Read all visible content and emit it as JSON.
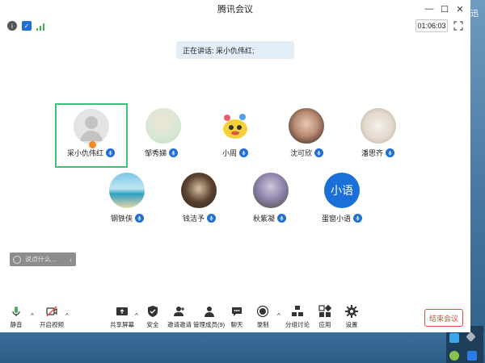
{
  "window": {
    "title": "腾讯会议",
    "timer": "01:06:03"
  },
  "desktop": {
    "edge_text": "迅"
  },
  "speaking": {
    "label": "正在讲话: 采小仇伟红;"
  },
  "participants": [
    {
      "name": "采小仇伟红",
      "avatar": "default-avatar"
    },
    {
      "name": "邹秀娣",
      "avatar": "photo-avatar"
    },
    {
      "name": "小周",
      "avatar": "photo-avatar"
    },
    {
      "name": "沈可欣",
      "avatar": "photo-avatar"
    },
    {
      "name": "潘思齐",
      "avatar": "photo-avatar"
    },
    {
      "name": "钢铁侠",
      "avatar": "photo-avatar"
    },
    {
      "name": "钱洁予",
      "avatar": "photo-avatar"
    },
    {
      "name": "秋紫凝",
      "avatar": "photo-avatar"
    },
    {
      "name": "蛋窗小语",
      "avatar": "text-avatar",
      "avatar_text": "小语"
    }
  ],
  "chat": {
    "placeholder": "说点什么..."
  },
  "toolbar": {
    "mute": "静音",
    "video": "开启视频",
    "share": "共享屏幕",
    "security": "安全",
    "invite": "邀请邀请",
    "members": "管理成员(9)",
    "chat": "聊天",
    "record": "录制",
    "breakout": "分组讨论",
    "apps": "应用",
    "settings": "设置",
    "end": "结束会议"
  },
  "colors": {
    "accent": "#1f6fd6",
    "end": "#e2473a",
    "highlight": "#3ec07a"
  }
}
